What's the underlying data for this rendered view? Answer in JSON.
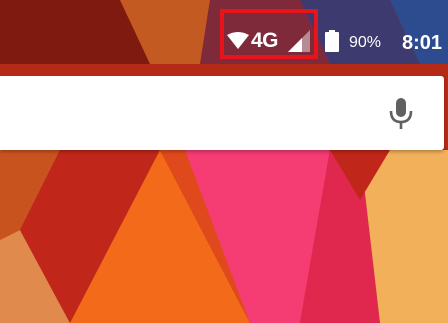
{
  "status_bar": {
    "network_type": "4G",
    "battery_level": "90%",
    "time": "8:01",
    "icons": [
      "wifi-icon",
      "cell-signal-icon",
      "battery-icon"
    ]
  },
  "search_bar": {
    "icon": "mic-icon"
  },
  "colors": {
    "highlight_box": "#e8141c",
    "status_text": "#ffffff",
    "search_background": "#ffffff",
    "mic_icon": "#616161"
  }
}
